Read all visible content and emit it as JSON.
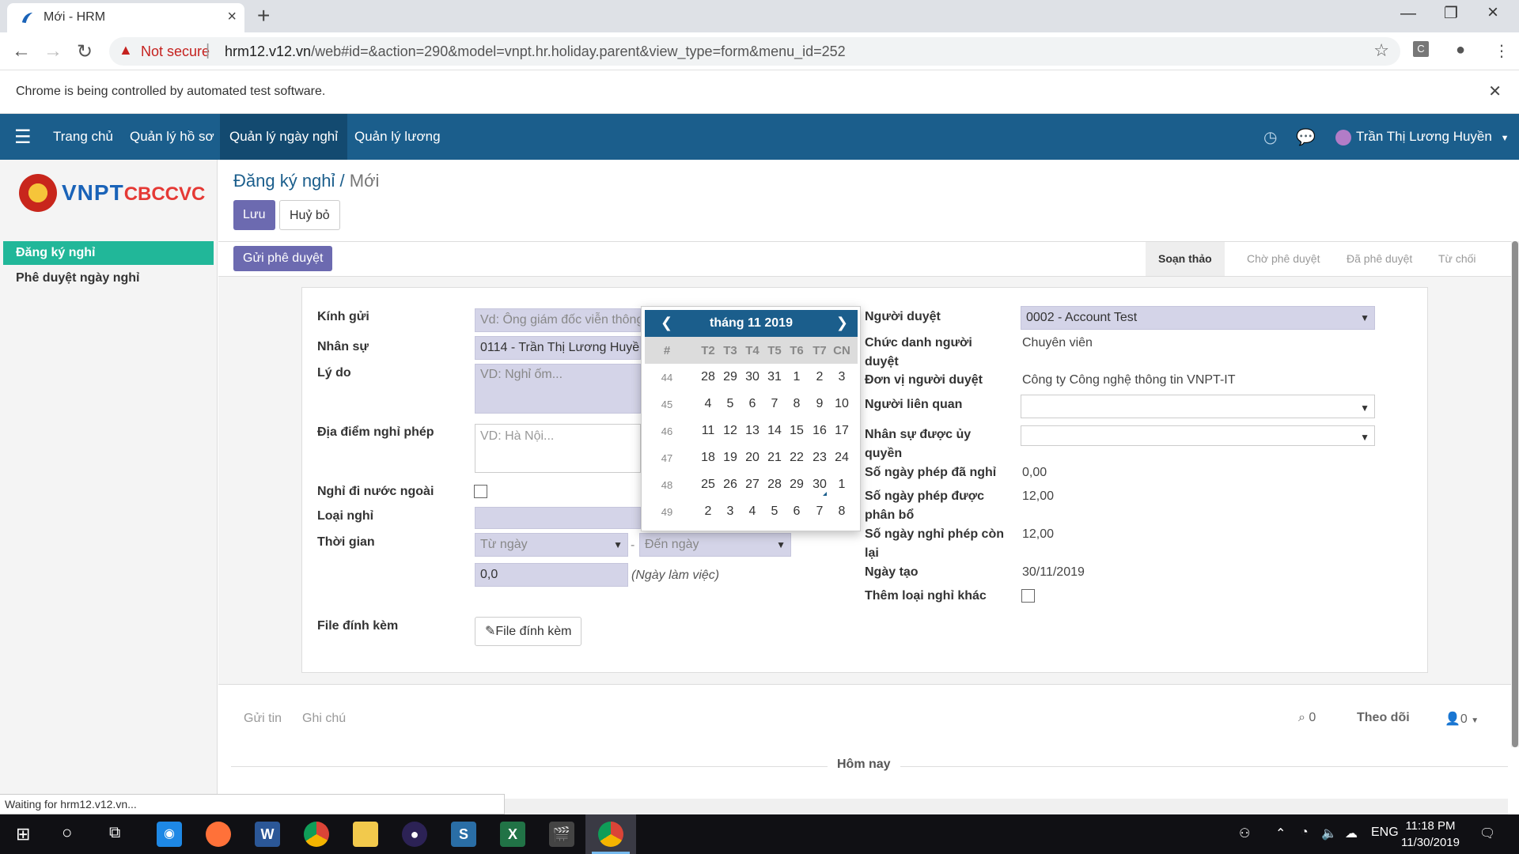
{
  "browser": {
    "tab_title": "Mới - HRM",
    "not_secure": "Not secure",
    "url_host": "hrm12.v12.vn",
    "url_path": "/web#id=&action=290&model=vnpt.hr.holiday.parent&view_type=form&menu_id=252",
    "infobar_message": "Chrome is being controlled by automated test software.",
    "status_bubble": "Waiting for hrm12.v12.vn..."
  },
  "topnav": {
    "menus": [
      "Trang chủ",
      "Quản lý hồ sơ",
      "Quản lý ngày nghỉ",
      "Quản lý lương"
    ],
    "active_index": 2,
    "user_name": "Trần Thị Lương Huyền"
  },
  "sidebar": {
    "logo_text": "VNPT",
    "logo_sub": "CBCCVC",
    "items": [
      "Đăng ký nghỉ",
      "Phê duyệt ngày nghỉ"
    ]
  },
  "page": {
    "breadcrumb_parent": "Đăng ký nghỉ",
    "breadcrumb_current": "Mới",
    "save_label": "Lưu",
    "cancel_label": "Huỷ bỏ",
    "submit_label": "Gửi phê duyệt",
    "stages": [
      "Soạn thảo",
      "Chờ phê duyệt",
      "Đã phê duyệt",
      "Từ chối"
    ],
    "current_stage": "Soạn thảo"
  },
  "form": {
    "left": {
      "kinh_gui_label": "Kính gửi",
      "kinh_gui_placeholder": "Vd: Ông giám đốc viễn thông",
      "nhan_su_label": "Nhân sự",
      "nhan_su_value": "0114 - Trần Thị Lương Huyền",
      "ly_do_label": "Lý do",
      "ly_do_placeholder": "VD: Nghỉ ốm...",
      "dia_diem_label": "Địa điểm nghỉ phép",
      "dia_diem_placeholder": "VD: Hà Nội...",
      "nuoc_ngoai_label": "Nghỉ đi nước ngoài",
      "loai_nghi_label": "Loại nghỉ",
      "thoi_gian_label": "Thời gian",
      "tu_ngay_placeholder": "Từ ngày",
      "den_ngay_placeholder": "Đến ngày",
      "dash": "-",
      "so_ngay_value": "0,0",
      "so_ngay_unit": "(Ngày làm việc)",
      "file_label": "File đính kèm",
      "file_button": "File đính kèm"
    },
    "right": {
      "nguoi_duyet_label": "Người duyệt",
      "nguoi_duyet_value": "0002 - Account Test",
      "chuc_danh_label": "Chức danh người duyệt",
      "chuc_danh_value": "Chuyên viên",
      "don_vi_label": "Đơn vị người duyệt",
      "don_vi_value": "Công ty Công nghệ thông tin VNPT-IT",
      "lien_quan_label": "Người liên quan",
      "uy_quyen_label": "Nhân sự được ủy quyền",
      "da_nghi_label": "Số ngày phép đã nghỉ",
      "da_nghi_value": "0,00",
      "phan_bo_label": "Số ngày phép được phân bổ",
      "phan_bo_value": "12,00",
      "con_lai_label": "Số ngày nghỉ phép còn lại",
      "con_lai_value": "12,00",
      "ngay_tao_label": "Ngày tạo",
      "ngay_tao_value": "30/11/2019",
      "them_loai_label": "Thêm loại nghỉ khác"
    }
  },
  "datepicker": {
    "month_label": "tháng 11 2019",
    "headers": [
      "#",
      "T2",
      "T3",
      "T4",
      "T5",
      "T6",
      "T7",
      "CN"
    ],
    "weeks": [
      {
        "wk": "44",
        "days": [
          "28",
          "29",
          "30",
          "31",
          "1",
          "2",
          "3"
        ]
      },
      {
        "wk": "45",
        "days": [
          "4",
          "5",
          "6",
          "7",
          "8",
          "9",
          "10"
        ]
      },
      {
        "wk": "46",
        "days": [
          "11",
          "12",
          "13",
          "14",
          "15",
          "16",
          "17"
        ]
      },
      {
        "wk": "47",
        "days": [
          "18",
          "19",
          "20",
          "21",
          "22",
          "23",
          "24"
        ]
      },
      {
        "wk": "48",
        "days": [
          "25",
          "26",
          "27",
          "28",
          "29",
          "30",
          "1"
        ]
      },
      {
        "wk": "49",
        "days": [
          "2",
          "3",
          "4",
          "5",
          "6",
          "7",
          "8"
        ]
      }
    ],
    "today": "30"
  },
  "chatter": {
    "send_message": "Gửi tin",
    "log_note": "Ghi chú",
    "attachments_count": "0",
    "follow_label": "Theo dõi",
    "followers_count": "0",
    "today_label": "Hôm nay"
  },
  "taskbar": {
    "apps": [
      "S",
      "X"
    ],
    "lang": "ENG",
    "time": "11:18 PM",
    "date": "11/30/2019"
  },
  "colors": {
    "nav_bg": "#1b5e8c",
    "primary_button": "#6c6ab0",
    "sidebar_active": "#21b799",
    "required_field": "#d4d4e8"
  }
}
